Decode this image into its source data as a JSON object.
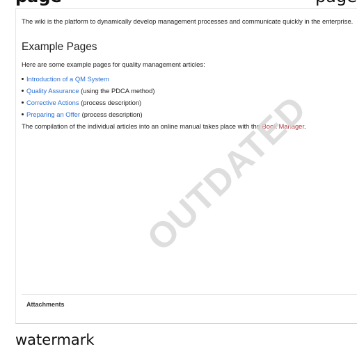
{
  "heading_cut": {
    "left_text": "page",
    "right_text": "page"
  },
  "intro_text": "The wiki is the platform to dynamically develop management processes and communicate quickly in the enterprise.",
  "section": {
    "title": "Example Pages",
    "subtext": "Here are some example pages for quality management articles:"
  },
  "examples": [
    {
      "link": "Introduction of a QM System",
      "suffix": ""
    },
    {
      "link": "Quality Assurance",
      "suffix": " (using the PDCA method)"
    },
    {
      "link": "Corrective Actions",
      "suffix": " (process description)"
    },
    {
      "link": "Preparing an Offer",
      "suffix": " (process description)"
    }
  ],
  "compilation": {
    "prefix": "The compilation of the individual articles into an online manual takes place with the ",
    "link": "Book Manager",
    "suffix": "."
  },
  "attachments_label": "Attachments",
  "watermark_text": "OUTDATED",
  "caption": "watermark",
  "colors": {
    "link": "#2a6fd6",
    "red_link": "#b0393d",
    "watermark": "#d8d8d8"
  }
}
